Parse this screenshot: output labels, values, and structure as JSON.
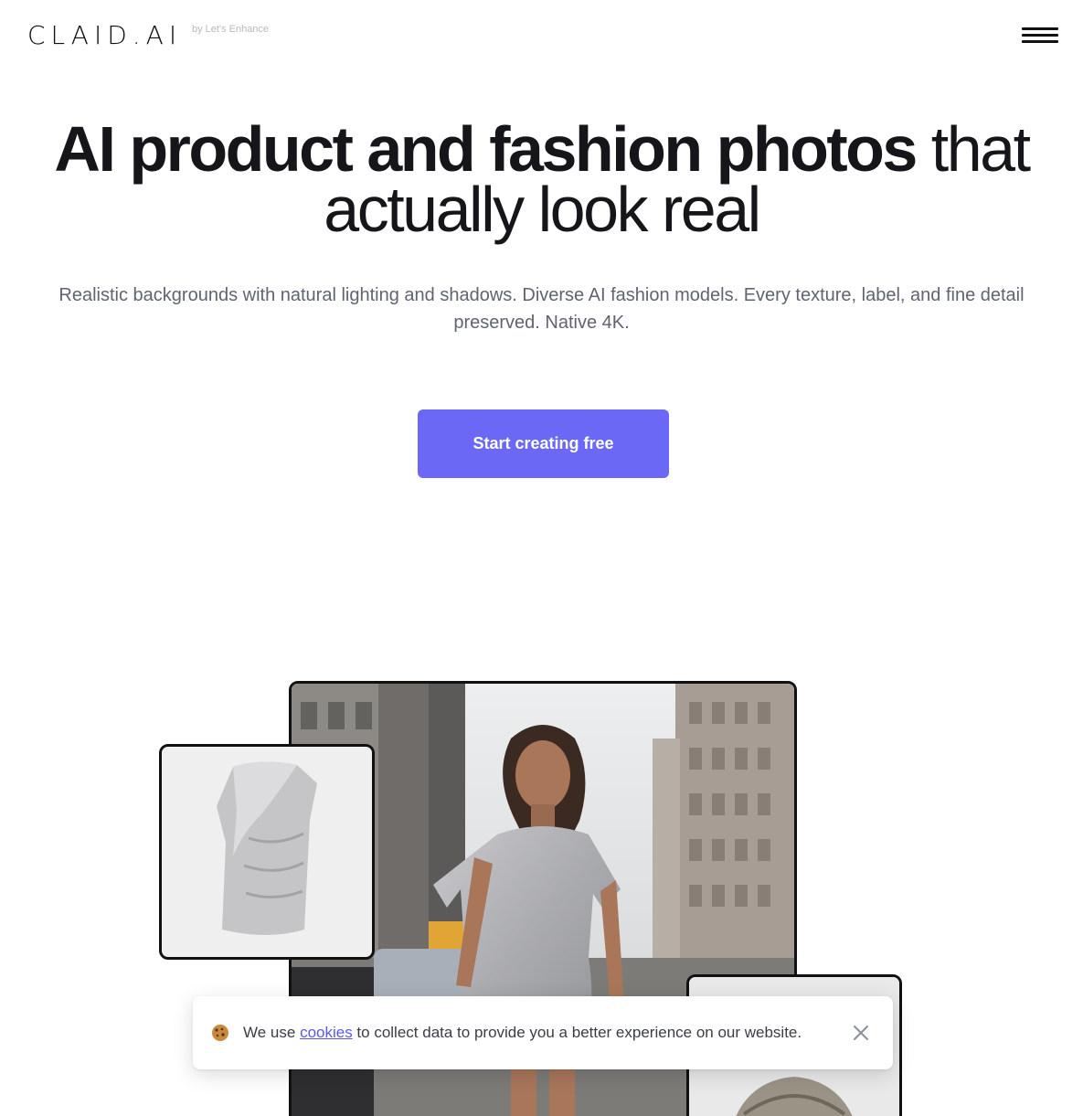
{
  "header": {
    "logo": "CLAID.AI",
    "logo_sub": "by Let's Enhance"
  },
  "hero": {
    "title_bold": "AI product and fashion photos",
    "title_light_1": " that",
    "title_light_2": "actually look real",
    "subtitle": "Realistic backgrounds with natural lighting and shadows. Diverse AI fashion models. Every texture, label, and fine detail preserved. Native 4K.",
    "cta_label": "Start creating free"
  },
  "cookie_banner": {
    "text_before": "We use ",
    "link_text": "cookies",
    "text_after": " to collect data to provide you a better experience on our website."
  },
  "colors": {
    "accent": "#6b68f5",
    "link": "#5b57e8",
    "text_dark": "#16161a",
    "text_muted": "#5f6470"
  },
  "icons": {
    "menu": "hamburger-menu-icon",
    "cookie": "cookie-icon",
    "close": "close-icon"
  }
}
